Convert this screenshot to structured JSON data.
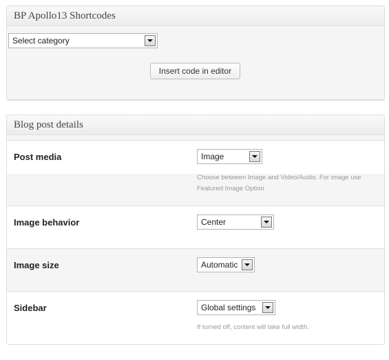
{
  "shortcodes_box": {
    "title": "BP Apollo13 Shortcodes",
    "category_select": "Select category",
    "insert_button": "Insert code in editor"
  },
  "blog_box": {
    "title": "Blog post details",
    "rows": [
      {
        "label": "Post media",
        "value": "Image",
        "description": "Choose between Image and Video/Audio. For image use Featured Image Option"
      },
      {
        "label": "Image behavior",
        "value": "Center",
        "description": ""
      },
      {
        "label": "Image size",
        "value": "Automatic",
        "description": ""
      },
      {
        "label": "Sidebar",
        "value": "Global settings",
        "description": "If turned off, content will take full width."
      }
    ]
  }
}
